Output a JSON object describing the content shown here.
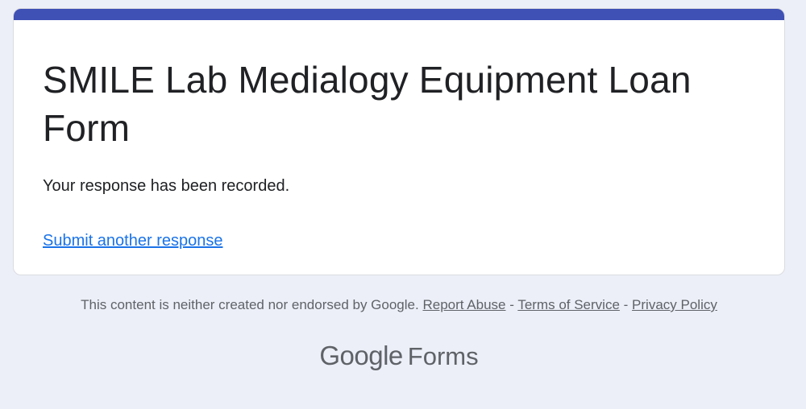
{
  "form": {
    "title": "SMILE Lab Medialogy Equipment Loan Form",
    "confirmation_message": "Your response has been recorded.",
    "submit_another_label": "Submit another response"
  },
  "footer": {
    "disclaimer": "This content is neither created nor endorsed by Google.",
    "separator": "-",
    "report_abuse": "Report Abuse",
    "terms_of_service": "Terms of Service",
    "privacy_policy": "Privacy Policy"
  },
  "brand": {
    "google": "Google",
    "forms": "Forms"
  },
  "colors": {
    "accent": "#3f51b5",
    "link": "#1a73e8",
    "background": "#edeff8"
  }
}
